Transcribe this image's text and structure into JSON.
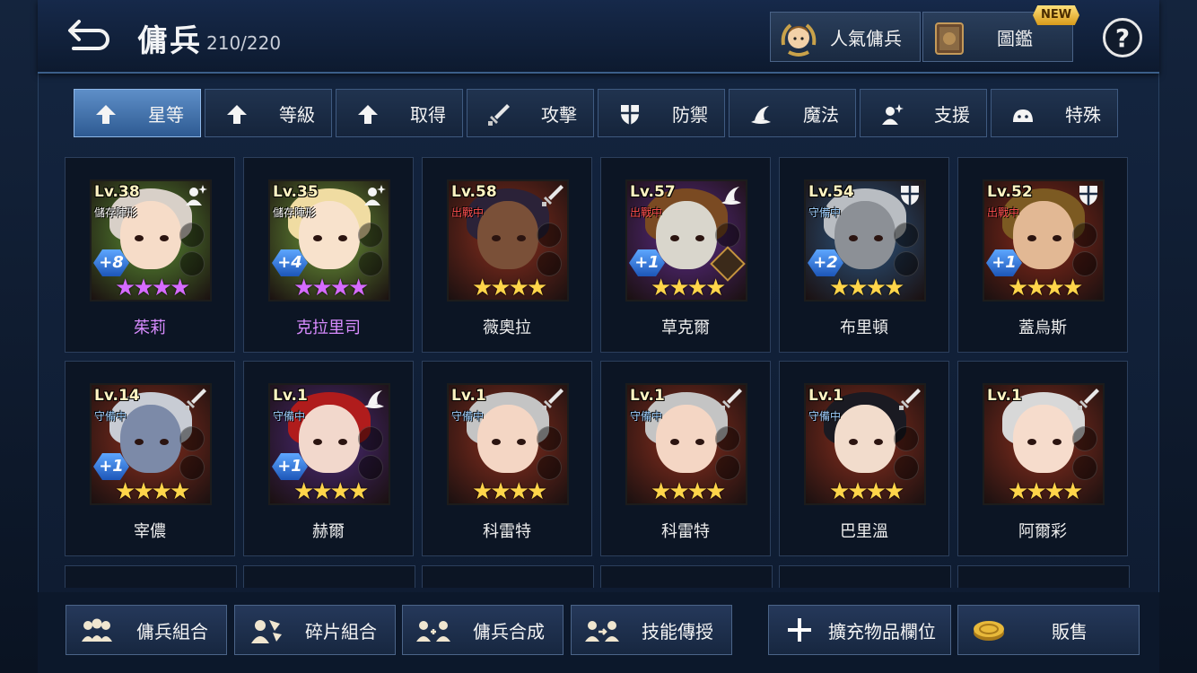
{
  "header": {
    "title": "傭兵",
    "count": "210/220",
    "popular_label": "人氣傭兵",
    "catalog_label": "圖鑑",
    "new_badge": "NEW",
    "help_label": "?"
  },
  "tabs": [
    {
      "label": "星等",
      "icon": "arrow-up-icon",
      "active": true
    },
    {
      "label": "等級",
      "icon": "arrow-up-icon",
      "active": false
    },
    {
      "label": "取得",
      "icon": "arrow-up-icon",
      "active": false
    },
    {
      "label": "攻擊",
      "icon": "sword-icon",
      "active": false
    },
    {
      "label": "防禦",
      "icon": "shield-icon",
      "active": false
    },
    {
      "label": "魔法",
      "icon": "wizard-hat-icon",
      "active": false
    },
    {
      "label": "支援",
      "icon": "support-icon",
      "active": false
    },
    {
      "label": "特殊",
      "icon": "slime-icon",
      "active": false
    }
  ],
  "heroes": [
    {
      "level": "Lv.38",
      "status": "儲存陣形",
      "status_type": "save",
      "plus": "+8",
      "role": "support",
      "stars": 4,
      "star_color": "purple",
      "name": "茱莉",
      "bg": "#5b8f34",
      "hair": "#d8d0c8",
      "skin": "#f6dcc8"
    },
    {
      "level": "Lv.35",
      "status": "儲存陣形",
      "status_type": "save",
      "plus": "+4",
      "role": "support",
      "stars": 4,
      "star_color": "purple",
      "name": "克拉里司",
      "bg": "#6d9a3a",
      "hair": "#f0dca2",
      "skin": "#f8e2cc"
    },
    {
      "level": "Lv.58",
      "status": "出戰中",
      "status_type": "out",
      "plus": "",
      "role": "attack",
      "stars": 4,
      "star_color": "gold",
      "name": "薇奧拉",
      "bg": "#8b2f1e",
      "hair": "#2b2238",
      "skin": "#7a5038"
    },
    {
      "level": "Lv.57",
      "status": "出戰中",
      "status_type": "out",
      "plus": "+1",
      "role": "magic",
      "stars": 4,
      "star_color": "gold",
      "name": "草克爾",
      "bg": "#5b2b86",
      "hair": "#7a4a22",
      "skin": "#d9d6cc"
    },
    {
      "level": "Lv.54",
      "status": "守備中",
      "status_type": "guard",
      "plus": "+2",
      "role": "defense",
      "stars": 4,
      "star_color": "gold",
      "name": "布里頓",
      "bg": "#2c5580",
      "hair": "#b9bdc2",
      "skin": "#8c9096"
    },
    {
      "level": "Lv.52",
      "status": "出戰中",
      "status_type": "out",
      "plus": "+1",
      "role": "defense",
      "stars": 4,
      "star_color": "gold",
      "name": "蓋烏斯",
      "bg": "#8a2a1a",
      "hair": "#7c5a22",
      "skin": "#e2b894"
    },
    {
      "level": "Lv.14",
      "status": "守備中",
      "status_type": "guard",
      "plus": "+1",
      "role": "attack",
      "stars": 4,
      "star_color": "gold",
      "name": "宰儂",
      "bg": "#8b2f1e",
      "hair": "#c8ccd4",
      "skin": "#7c8aa8"
    },
    {
      "level": "Lv.1",
      "status": "守備中",
      "status_type": "guard",
      "plus": "+1",
      "role": "magic",
      "stars": 4,
      "star_color": "gold",
      "name": "赫爾",
      "bg": "#4c2a7a",
      "hair": "#b01c1c",
      "skin": "#f2d8cc"
    },
    {
      "level": "Lv.1",
      "status": "守備中",
      "status_type": "guard",
      "plus": "",
      "role": "attack",
      "stars": 4,
      "star_color": "gold",
      "name": "科雷特",
      "bg": "#8b2f1e",
      "hair": "#c4c4c4",
      "skin": "#f4d6c4"
    },
    {
      "level": "Lv.1",
      "status": "守備中",
      "status_type": "guard",
      "plus": "",
      "role": "attack",
      "stars": 4,
      "star_color": "gold",
      "name": "科雷特",
      "bg": "#8b2f1e",
      "hair": "#c4c4c4",
      "skin": "#f4d6c4"
    },
    {
      "level": "Lv.1",
      "status": "守備中",
      "status_type": "guard",
      "plus": "",
      "role": "attack",
      "stars": 4,
      "star_color": "gold",
      "name": "巴里溫",
      "bg": "#8b2f1e",
      "hair": "#1a1a22",
      "skin": "#f2dccc"
    },
    {
      "level": "Lv.1",
      "status": "",
      "status_type": "save",
      "plus": "",
      "role": "attack",
      "stars": 4,
      "star_color": "gold",
      "name": "阿爾彩",
      "bg": "#8b2f1e",
      "hair": "#d8d8d8",
      "skin": "#f6dccc"
    }
  ],
  "footer": {
    "combine_label": "傭兵組合",
    "fragment_label": "碎片組合",
    "fuse_label": "傭兵合成",
    "skill_label": "技能傳授",
    "expand_label": "擴充物品欄位",
    "sell_label": "販售"
  },
  "colors": {
    "accent": "#5e8fc8",
    "gold_star": "#ffd54a",
    "purple_star": "#d66bff",
    "out_status": "#ff5050",
    "guard_status": "#9fd0ff"
  }
}
